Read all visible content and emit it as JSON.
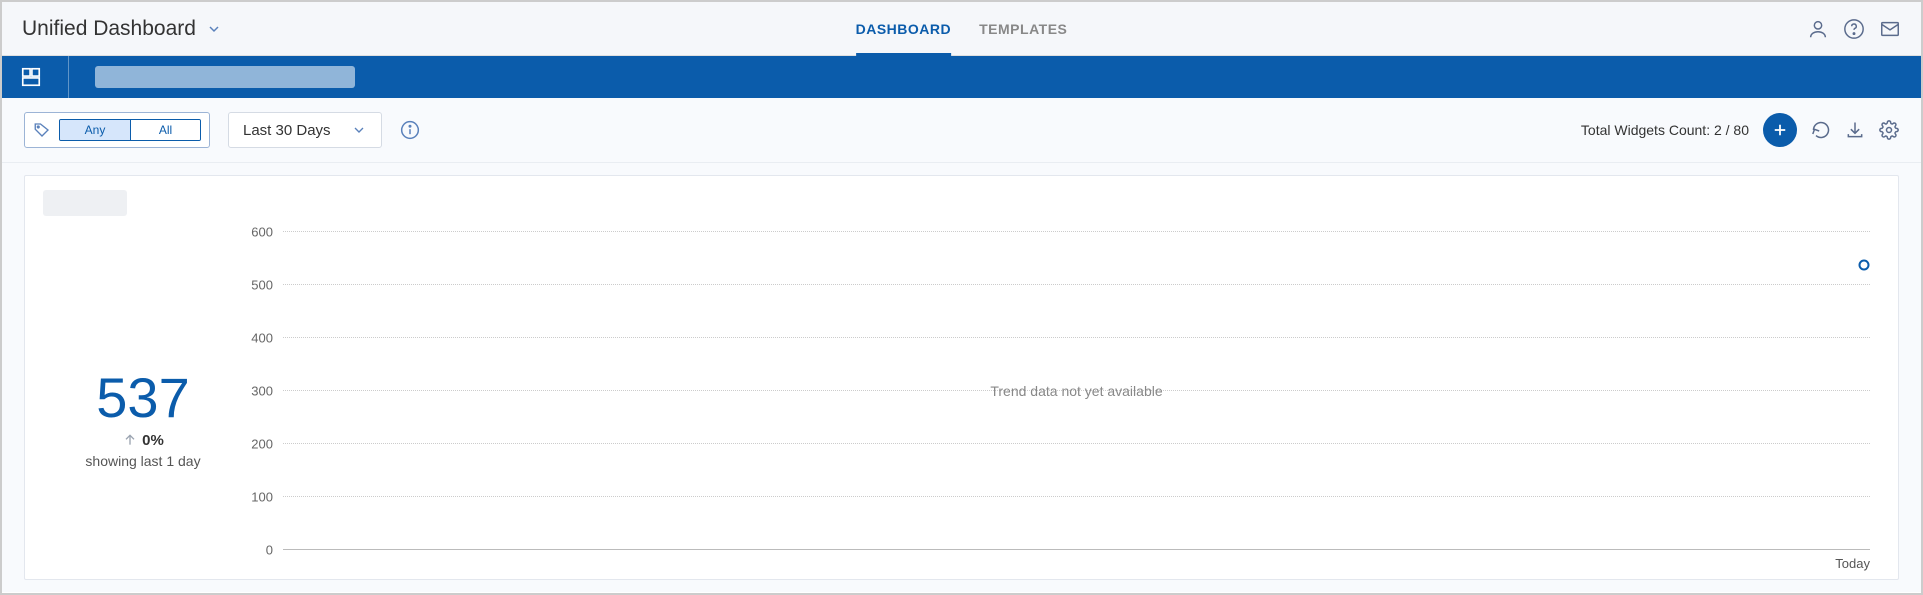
{
  "header": {
    "title": "Unified Dashboard",
    "tabs": {
      "dashboard": "DASHBOARD",
      "templates": "TEMPLATES"
    }
  },
  "toolbar": {
    "toggle_any": "Any",
    "toggle_all": "All",
    "date_range": "Last 30 Days",
    "widget_count_label": "Total Widgets Count: 2 / 80"
  },
  "widget": {
    "summary": {
      "value": "537",
      "trend_value": "0%",
      "showing": "showing last 1 day"
    },
    "chart_message": "Trend data not yet available",
    "xaxis": {
      "today": "Today"
    },
    "ticks": {
      "t0": "0",
      "t100": "100",
      "t200": "200",
      "t300": "300",
      "t400": "400",
      "t500": "500",
      "t600": "600"
    }
  },
  "chart_data": {
    "type": "line",
    "title": "",
    "xlabel": "",
    "ylabel": "",
    "ylim": [
      0,
      600
    ],
    "y_ticks": [
      0,
      100,
      200,
      300,
      400,
      500,
      600
    ],
    "categories": [
      "Today"
    ],
    "series": [
      {
        "name": "value",
        "values": [
          537
        ]
      }
    ],
    "message": "Trend data not yet available"
  }
}
